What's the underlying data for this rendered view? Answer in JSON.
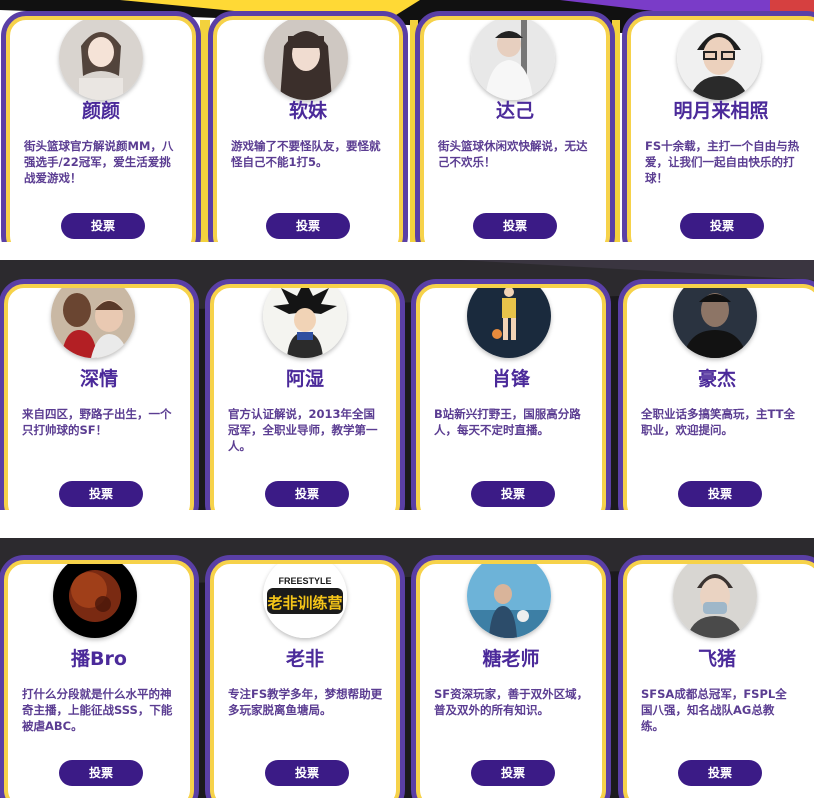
{
  "vote_label": "投票",
  "colors": {
    "accent": "#3b1b86",
    "name": "#4b2a9a",
    "frame": "#f6d24a",
    "frame_outer": "#5a3fa6"
  },
  "rows": [
    {
      "cards": [
        {
          "name": "颜颜",
          "desc": "街头篮球官方解说颜MM，八强选手/22冠军，爱生活爱挑战爱游戏！",
          "avatar": "avatar-woman-photo"
        },
        {
          "name": "软妹",
          "desc": "游戏输了不要怪队友，要怪就怪自己不能1打5。",
          "avatar": "avatar-girl-photo"
        },
        {
          "name": "达己",
          "desc": "街头篮球休闲欢快解说，无达己不欢乐！",
          "avatar": "avatar-man-cap-photo"
        },
        {
          "name": "明月来相照",
          "desc": "FS十余载，主打一个自由与热爱，让我们一起自由快乐的打球！",
          "avatar": "avatar-man-glasses-photo"
        }
      ]
    },
    {
      "cards": [
        {
          "name": "深情",
          "desc": "来自四区，野路子出生，一个只打帅球的SF！",
          "avatar": "avatar-two-men-photo"
        },
        {
          "name": "阿湿",
          "desc": "官方认证解说，2013年全国冠军，全职业导师，教学第一人。",
          "avatar": "avatar-anime-character"
        },
        {
          "name": "肖锋",
          "desc": "B站新兴打野王，国服高分路人，每天不定时直播。",
          "avatar": "avatar-basketball-player-figure"
        },
        {
          "name": "豪杰",
          "desc": "全职业话多搞笑高玩，主TT全职业，欢迎提问。",
          "avatar": "avatar-dark-man-photo"
        }
      ]
    },
    {
      "cards": [
        {
          "name": "播Bro",
          "desc": "打什么分段就是什么水平的神奇主播，上能征战SSS，下能被虐ABC。",
          "avatar": "avatar-planet-dark"
        },
        {
          "name": "老非",
          "desc": "专注FS教学多年，梦想帮助更多玩家脱离鱼塘局。",
          "avatar": "avatar-freestyle-logo",
          "logo_top": "FREESTYLE",
          "logo_main": "老非训练营"
        },
        {
          "name": "糖老师",
          "desc": "SF资深玩家，善于双外区域，普及双外的所有知识。",
          "avatar": "avatar-blue-sky-photo"
        },
        {
          "name": "飞猪",
          "desc": "SFSA成都总冠军，FSPL全国八强，知名战队AG总教练。",
          "avatar": "avatar-man-mask-photo"
        }
      ]
    }
  ]
}
